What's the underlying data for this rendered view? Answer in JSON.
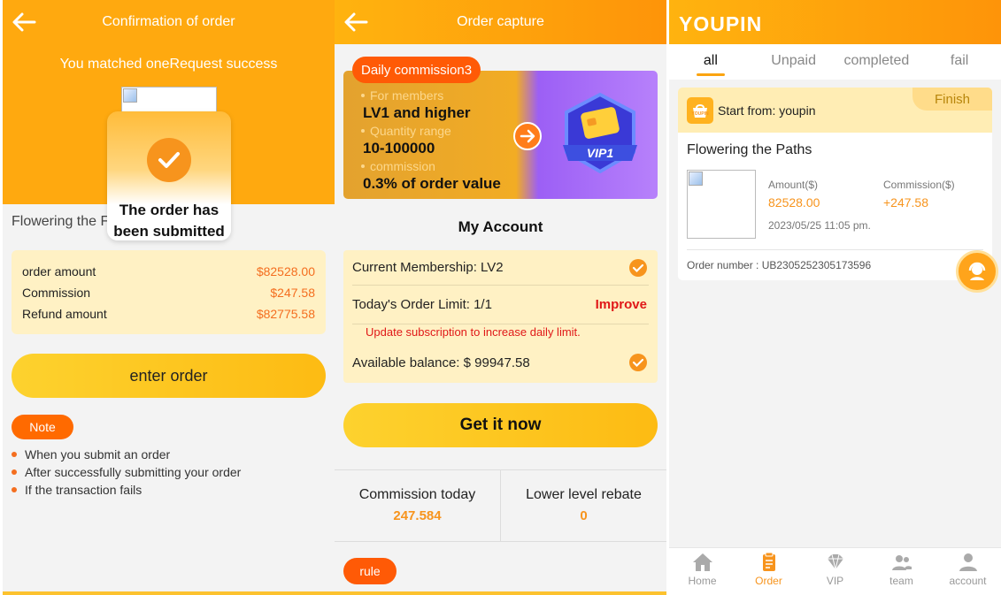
{
  "confirm": {
    "title": "Confirmation of order",
    "match_msg": "You matched oneRequest success",
    "submitted_line1": "The order has",
    "submitted_line2": "been submitted",
    "product_title": "Flowering the F",
    "rows": [
      {
        "label": "order amount",
        "value": "$82528.00"
      },
      {
        "label": "Commission",
        "value": "$247.58"
      },
      {
        "label": "Refund amount",
        "value": "$82775.58"
      }
    ],
    "enter_label": "enter order",
    "note_label": "Note",
    "notes": [
      "When you submit an order",
      "After successfully submitting your order",
      "If the transaction fails"
    ]
  },
  "capture": {
    "title": "Order capture",
    "banner": {
      "pill": "Daily commission3",
      "for_members": "For members",
      "level": "LV1 and higher",
      "quantity_range": "Quantity range",
      "range": "10-100000",
      "commission": "commission",
      "rate": "0.3% of order value",
      "vip_label": "VIP1"
    },
    "section_title": "My Account",
    "membership": "Current Membership: LV2",
    "order_limit": "Today's Order Limit: 1/1",
    "improve": "Improve",
    "update_msg": "Update subscription to increase daily limit.",
    "balance": "Available balance: $ 99947.58",
    "get_btn": "Get it now",
    "commission_today_label": "Commission today",
    "commission_today_value": "247.584",
    "rebate_label": "Lower level rebate",
    "rebate_value": "0",
    "rule_label": "rule"
  },
  "orders": {
    "logo": "YOUPIN",
    "tabs": [
      "all",
      "Unpaid",
      "completed",
      "fail"
    ],
    "active_tab": "all",
    "card": {
      "logo_text": "YOUPIN",
      "from": "Start from: youpin",
      "status": "Finish",
      "name": "Flowering the Paths",
      "amount_label": "Amount($)",
      "amount": "82528.00",
      "commission_label": "Commission($)",
      "commission": "+247.58",
      "date": "2023/05/25 11:05 pm.",
      "order_number": "Order number : UB2305252305173596"
    },
    "nav": [
      {
        "label": "Home",
        "icon": "home-icon"
      },
      {
        "label": "Order",
        "icon": "order-icon"
      },
      {
        "label": "VIP",
        "icon": "diamond-icon"
      },
      {
        "label": "team",
        "icon": "team-icon"
      },
      {
        "label": "account",
        "icon": "account-icon"
      }
    ],
    "active_nav": "Order"
  },
  "colors": {
    "accent": "#fba410",
    "price": "#f46e1f",
    "alert": "#e01818"
  }
}
